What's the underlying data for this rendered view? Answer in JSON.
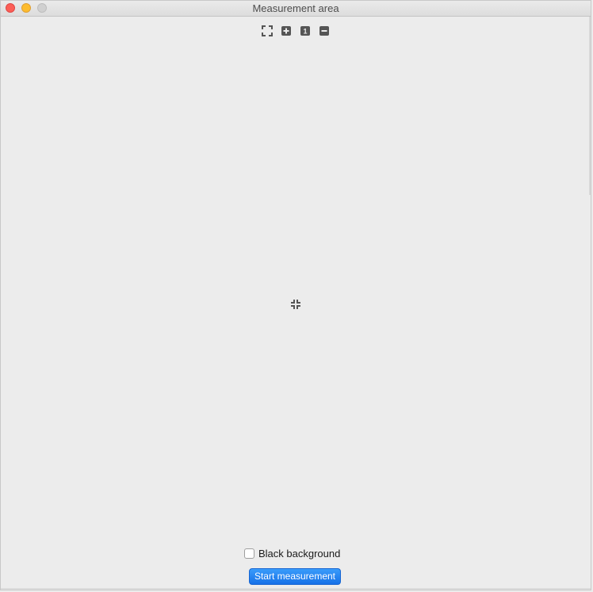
{
  "window": {
    "title": "Measurement area"
  },
  "toolbar": {
    "tools": [
      {
        "name": "fullscreen",
        "icon": "fullscreen-icon"
      },
      {
        "name": "zoom-in",
        "icon": "plus-icon"
      },
      {
        "name": "actual-size",
        "icon": "one-to-one-icon",
        "glyph": "1"
      },
      {
        "name": "zoom-out",
        "icon": "minus-icon"
      }
    ]
  },
  "canvas": {
    "center_icon": "exit-fullscreen-icon"
  },
  "controls": {
    "black_background_label": "Black background",
    "black_background_checked": false,
    "start_label": "Start measurement"
  },
  "colors": {
    "accent": "#1e7cf0",
    "icon": "#555555",
    "background": "#ececec"
  }
}
